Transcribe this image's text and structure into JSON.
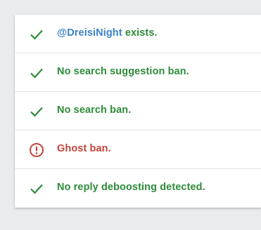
{
  "colors": {
    "ok": "#2e8b3a",
    "bad": "#c2443b",
    "link": "#3b82c4"
  },
  "results": [
    {
      "status": "ok",
      "icon": "check-icon",
      "username": "@DreisiNight",
      "text": " exists."
    },
    {
      "status": "ok",
      "icon": "check-icon",
      "text": "No search suggestion ban."
    },
    {
      "status": "ok",
      "icon": "check-icon",
      "text": "No search ban."
    },
    {
      "status": "bad",
      "icon": "alert-circle-icon",
      "text": "Ghost ban."
    },
    {
      "status": "ok",
      "icon": "check-icon",
      "text": "No reply deboosting detected."
    }
  ]
}
